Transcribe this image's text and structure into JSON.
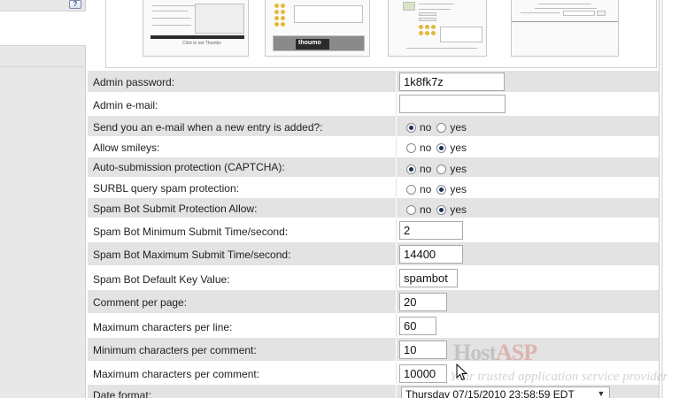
{
  "thumbnails": [
    {
      "caption": "Click to set Thumbs"
    },
    {
      "logo": "thoumo"
    },
    {},
    {}
  ],
  "fields": [
    {
      "label": "Admin password:",
      "type": "text",
      "value": "1k8fk7z"
    },
    {
      "label": "Admin e-mail:",
      "type": "text",
      "value": ""
    },
    {
      "label": "Send you an e-mail when a new entry is added?:",
      "type": "radio",
      "options": [
        "no",
        "yes"
      ],
      "selected": "no"
    },
    {
      "label": "Allow smileys:",
      "type": "radio",
      "options": [
        "no",
        "yes"
      ],
      "selected": "yes"
    },
    {
      "label": "Auto-submission protection (CAPTCHA):",
      "type": "radio",
      "options": [
        "no",
        "yes"
      ],
      "selected": "no"
    },
    {
      "label": "SURBL query spam protection:",
      "type": "radio",
      "options": [
        "no",
        "yes"
      ],
      "selected": "yes"
    },
    {
      "label": "Spam Bot Submit Protection Allow:",
      "type": "radio",
      "options": [
        "no",
        "yes"
      ],
      "selected": "yes"
    },
    {
      "label": "Spam Bot Minimum Submit Time/second:",
      "type": "text",
      "value": "2"
    },
    {
      "label": "Spam Bot Maximum Submit Time/second:",
      "type": "text",
      "value": "14400"
    },
    {
      "label": "Spam Bot Default Key Value:",
      "type": "text",
      "value": "spambot"
    },
    {
      "label": "Comment per page:",
      "type": "text",
      "value": "20"
    },
    {
      "label": "Maximum characters per line:",
      "type": "text",
      "value": "60"
    },
    {
      "label": "Minimum characters per comment:",
      "type": "text",
      "value": "10"
    },
    {
      "label": "Maximum characters per comment:",
      "type": "text",
      "value": "10000"
    },
    {
      "label": "Date format:",
      "type": "select",
      "value": "Thursday 07/15/2010 23:58:59 EDT"
    }
  ],
  "watermark": {
    "brand_host": "Host",
    "brand_asp": "ASP",
    "tagline": "Your trusted application service provider"
  },
  "icons": {
    "help": "help-icon",
    "cursor": "mouse-pointer-icon"
  }
}
